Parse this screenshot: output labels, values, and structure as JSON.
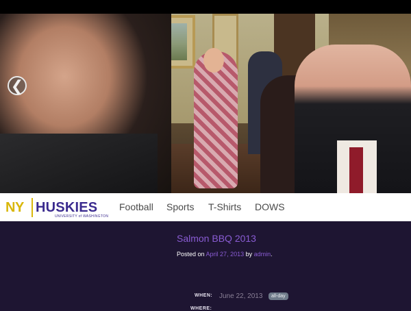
{
  "colors": {
    "accent_purple": "#8a5cd4",
    "brand_gold": "#d9b70a",
    "brand_purple": "#3a2a8e",
    "content_bg": "#1e1532"
  },
  "slider": {
    "prev_icon": "chevron-left-icon",
    "prev_glyph": "❮"
  },
  "logo": {
    "ny": "NY",
    "huskies": "HUSKIES",
    "sub": "UNIVERSITY of WASHINGTON"
  },
  "nav": {
    "items": [
      {
        "label": "Football"
      },
      {
        "label": "Sports"
      },
      {
        "label": "T-Shirts"
      },
      {
        "label": "DOWS"
      }
    ]
  },
  "post": {
    "title": "Salmon BBQ 2013",
    "posted_on": "Posted on",
    "date": "April 27, 2013",
    "by": "by",
    "author": "admin",
    "period": ".",
    "when_label": "WHEN:",
    "when_value": "June 22, 2013",
    "badge": "all-day",
    "where_label": "WHERE:"
  }
}
